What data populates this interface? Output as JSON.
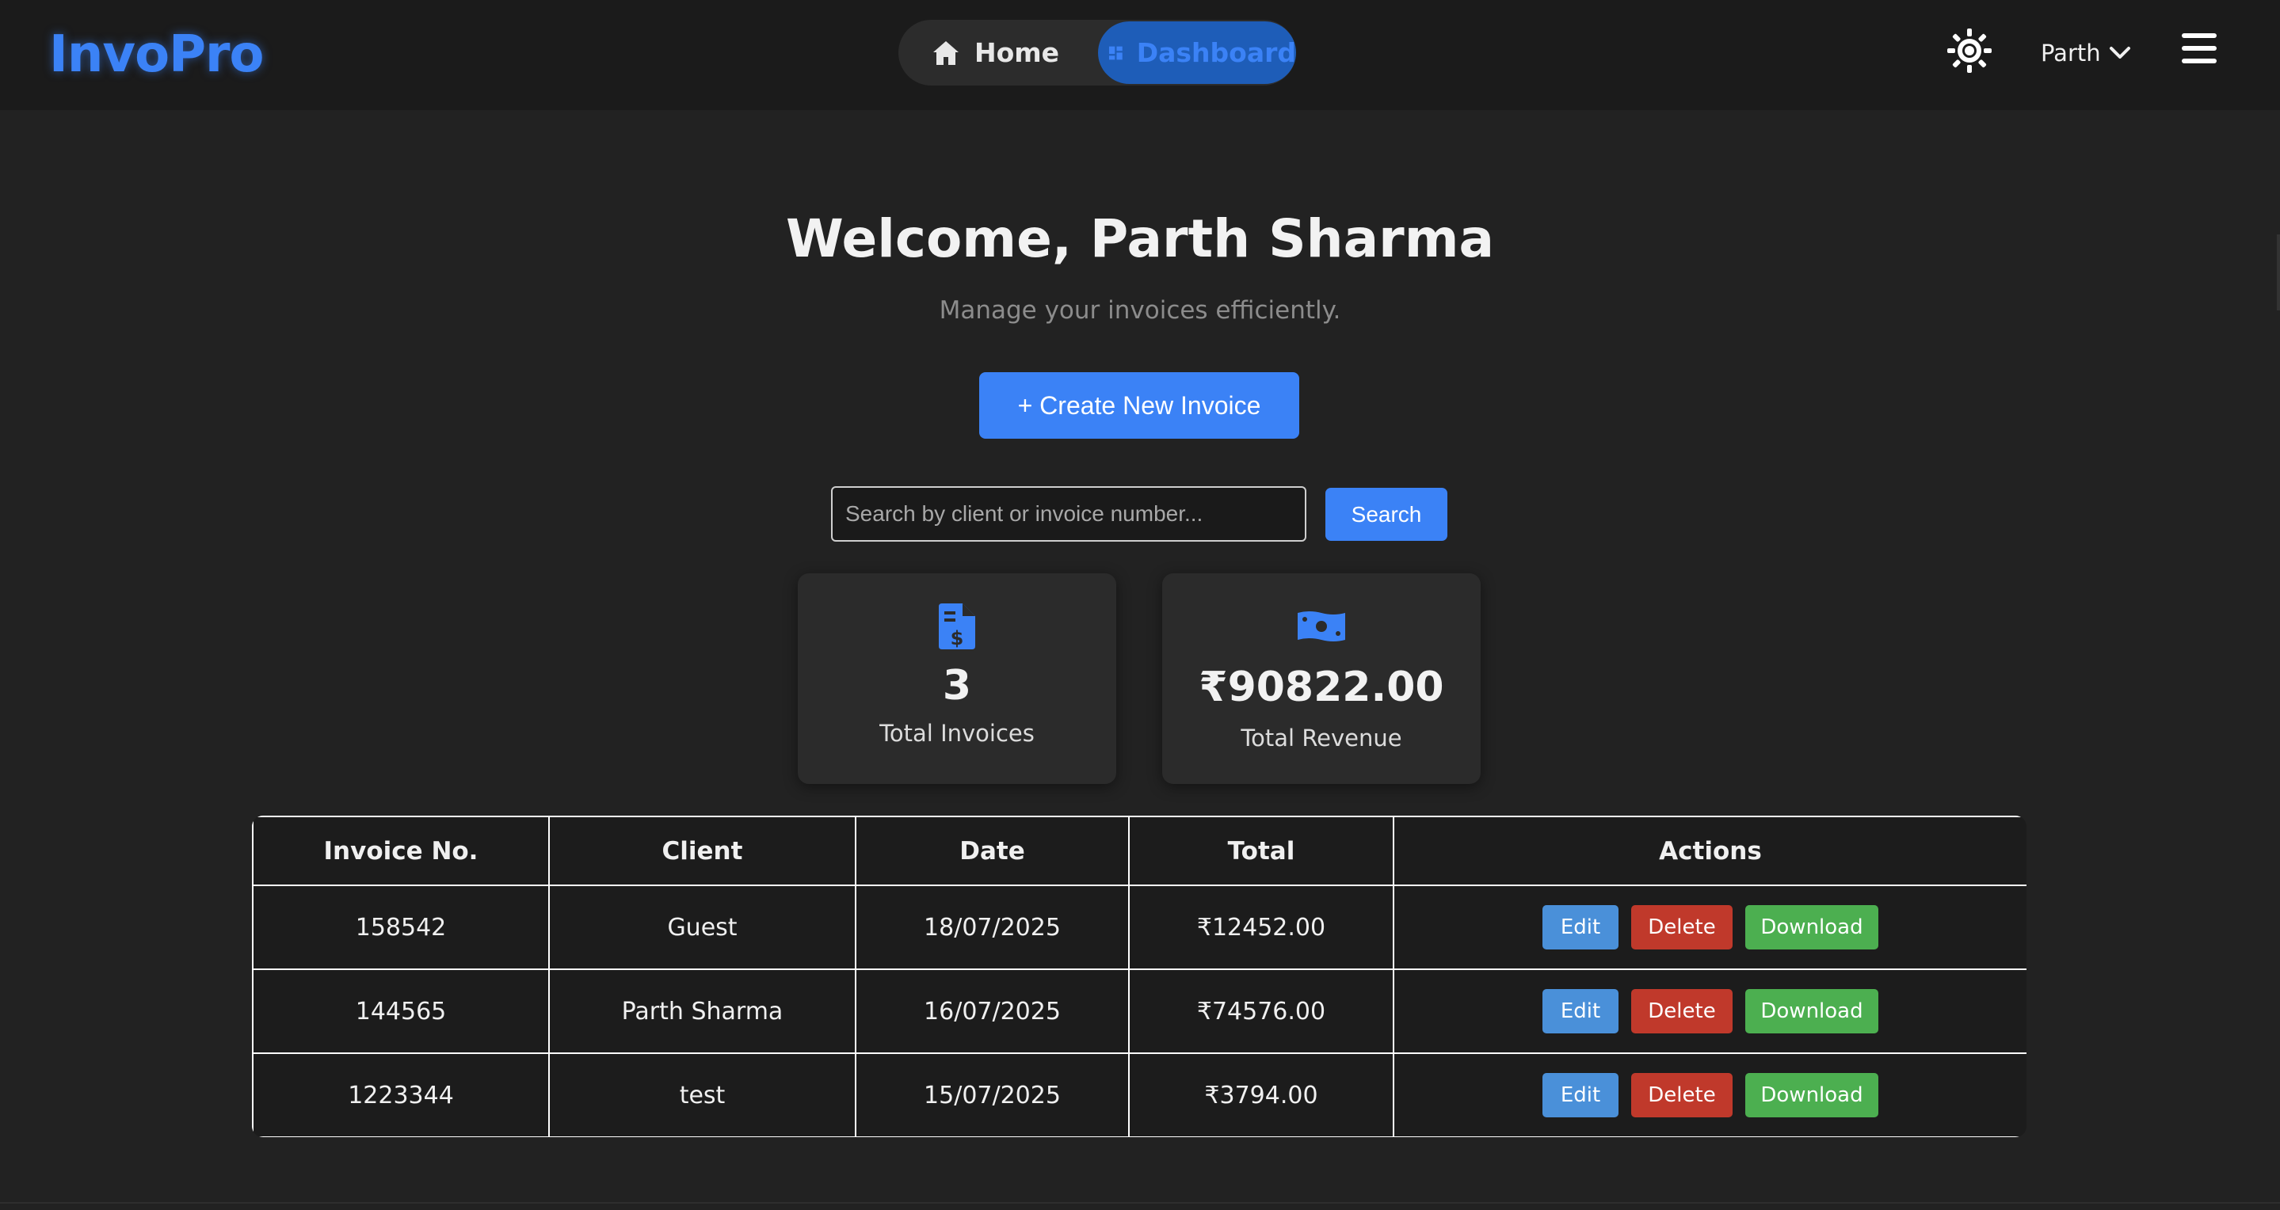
{
  "navbar": {
    "brand": "InvoPro",
    "home_label": "Home",
    "dashboard_label": "Dashboard",
    "user_name": "Parth",
    "theme_icon": "sun-icon",
    "menu_icon": "hamburger-menu-icon"
  },
  "hero": {
    "title": "Welcome, Parth Sharma",
    "subtitle": "Manage your invoices efficiently.",
    "create_button": "+ Create New Invoice"
  },
  "search": {
    "placeholder": "Search by client or invoice number...",
    "value": "",
    "button": "Search"
  },
  "stats": [
    {
      "icon": "invoice-dollar-icon",
      "value": "3",
      "label": "Total Invoices"
    },
    {
      "icon": "money-bill-icon",
      "value": "₹90822.00",
      "label": "Total Revenue"
    }
  ],
  "table": {
    "headers": [
      "Invoice No.",
      "Client",
      "Date",
      "Total",
      "Actions"
    ],
    "rows": [
      {
        "invoice_no": "158542",
        "client": "Guest",
        "date": "18/07/2025",
        "total": "₹12452.00"
      },
      {
        "invoice_no": "144565",
        "client": "Parth Sharma",
        "date": "16/07/2025",
        "total": "₹74576.00"
      },
      {
        "invoice_no": "1223344",
        "client": "test",
        "date": "15/07/2025",
        "total": "₹3794.00"
      }
    ],
    "actions": {
      "edit": "Edit",
      "delete": "Delete",
      "download": "Download"
    }
  },
  "colors": {
    "accent": "#3b82f6",
    "edit": "#4a90d9",
    "delete": "#c0392b",
    "download": "#4caf50",
    "background": "#222222"
  }
}
